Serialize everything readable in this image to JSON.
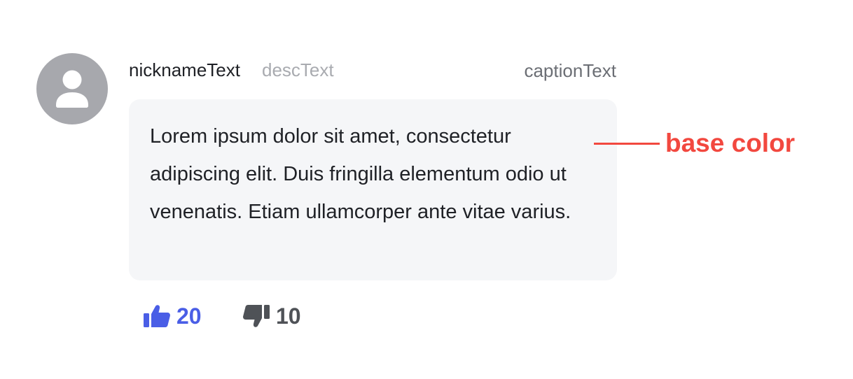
{
  "comment": {
    "nickname": "nicknameText",
    "desc": "descText",
    "caption": "captionText",
    "body": "Lorem ipsum dolor sit amet, consectetur adipiscing elit. Duis fringilla elementum odio ut venenatis. Etiam ullamcorper ante vitae varius.",
    "avatar_icon": "user-icon",
    "avatar_color": "#a7a8ad",
    "bubble_color": "#f5f6f8"
  },
  "annotation": {
    "label": "base color",
    "color": "#f2483f"
  },
  "reactions": {
    "like": {
      "count": "20",
      "icon": "thumbs-up-icon",
      "color": "#4a5ee6"
    },
    "dislike": {
      "count": "10",
      "icon": "thumbs-down-icon",
      "color": "#4f5257"
    }
  }
}
